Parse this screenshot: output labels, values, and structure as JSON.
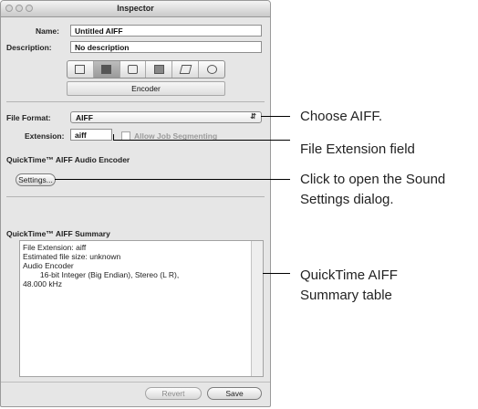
{
  "window": {
    "title": "Inspector"
  },
  "form": {
    "name_label": "Name:",
    "name_value": "Untitled AIFF",
    "description_label": "Description:",
    "description_value": "No description"
  },
  "toolbar": {
    "icons": [
      "summary-icon",
      "encoder-icon",
      "filters-icon",
      "frame-controls-icon",
      "geometry-icon",
      "actions-icon"
    ],
    "active_index": 1
  },
  "tab": {
    "label": "Encoder"
  },
  "encoder": {
    "file_format_label": "File Format:",
    "file_format_value": "AIFF",
    "extension_label": "Extension:",
    "extension_value": "aiff",
    "allow_segmenting_label": "Allow Job Segmenting",
    "section_title": "QuickTime™ AIFF Audio Encoder",
    "settings_button": "Settings...",
    "summary_title": "QuickTime™ AIFF Summary",
    "summary_text": "File Extension: aiff\nEstimated file size: unknown\nAudio Encoder\n        16-bit Integer (Big Endian), Stereo (L R),\n48.000 kHz"
  },
  "buttons": {
    "revert": "Revert",
    "save": "Save"
  },
  "callouts": {
    "c1": "Choose AIFF.",
    "c2": "File Extension field",
    "c3a": "Click to open the Sound",
    "c3b": "Settings dialog.",
    "c4a": "QuickTime AIFF",
    "c4b": "Summary table"
  }
}
